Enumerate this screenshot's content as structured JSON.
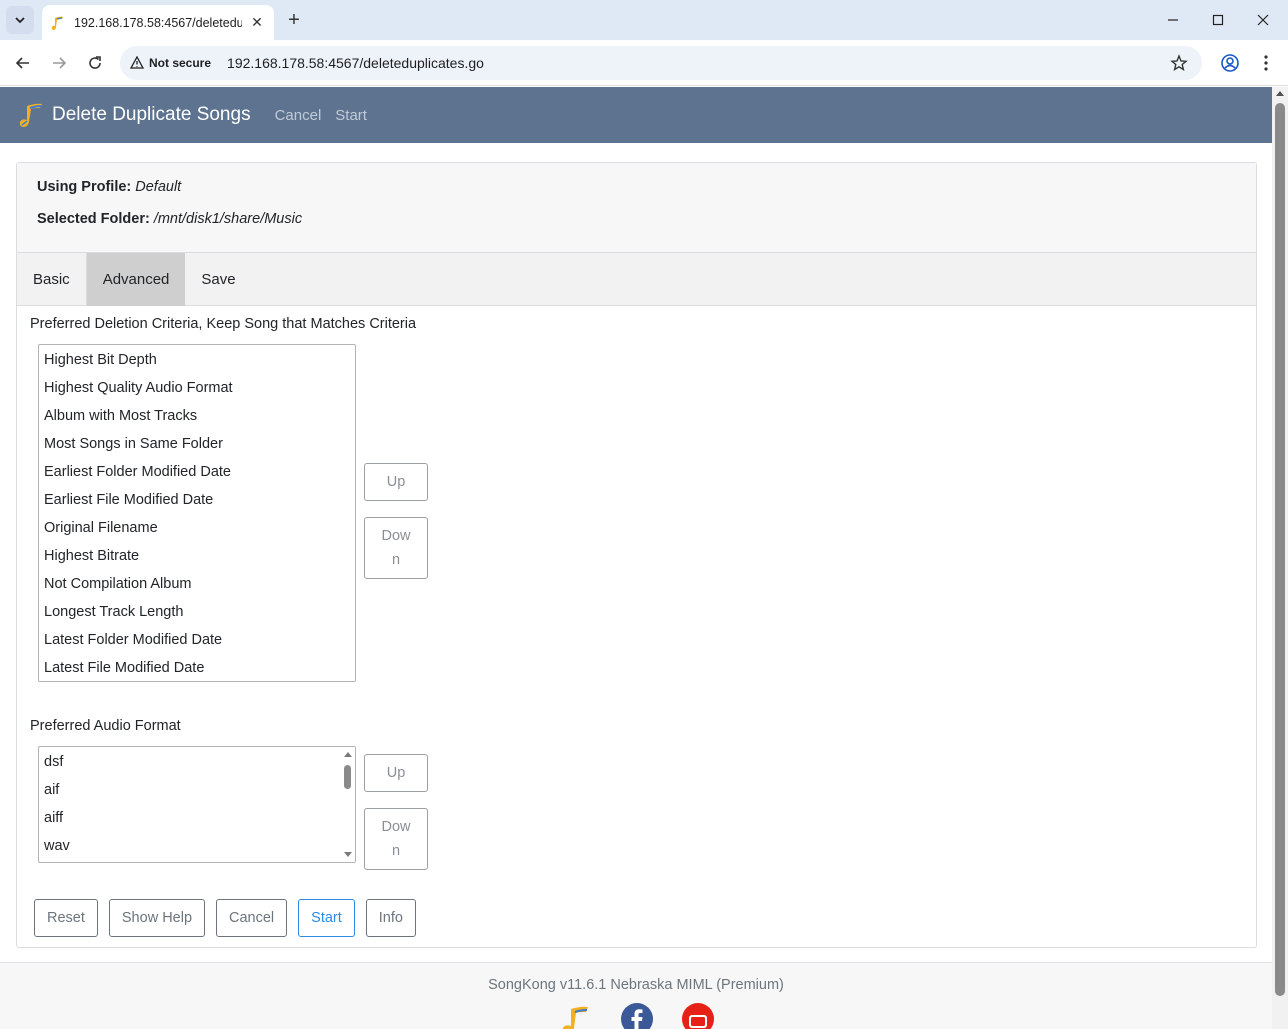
{
  "browser": {
    "tab_title": "192.168.178.58:4567/deletedup",
    "security_label": "Not secure",
    "url": "192.168.178.58:4567/deleteduplicates.go"
  },
  "appbar": {
    "title": "Delete Duplicate Songs",
    "cancel_label": "Cancel",
    "start_label": "Start"
  },
  "info": {
    "profile_label": "Using Profile:",
    "profile_value": "Default",
    "folder_label": "Selected Folder:",
    "folder_value": "/mnt/disk1/share/Music"
  },
  "tabs": [
    "Basic",
    "Advanced",
    "Save"
  ],
  "active_tab": "Advanced",
  "deletion_criteria": {
    "label": "Preferred Deletion Criteria, Keep Song that Matches Criteria",
    "items": [
      "Highest Bit Depth",
      "Highest Quality Audio Format",
      "Album with Most Tracks",
      "Most Songs in Same Folder",
      "Earliest Folder Modified Date",
      "Earliest File Modified Date",
      "Original Filename",
      "Highest Bitrate",
      "Not Compilation Album",
      "Longest Track Length",
      "Latest Folder Modified Date",
      "Latest File Modified Date"
    ],
    "up_label": "Up",
    "down_label": "Down"
  },
  "audio_format": {
    "label": "Preferred Audio Format",
    "items": [
      "dsf",
      "aif",
      "aiff",
      "wav"
    ],
    "up_label": "Up",
    "down_label": "Down"
  },
  "actions": {
    "reset": "Reset",
    "show_help": "Show Help",
    "cancel": "Cancel",
    "start": "Start",
    "info": "Info"
  },
  "footer": {
    "text": "SongKong v11.6.1 Nebraska MIML (Premium)"
  },
  "colors": {
    "appbar": "#5d7390",
    "primary": "#2b8be6",
    "active_tab": "#cfcfcf"
  }
}
